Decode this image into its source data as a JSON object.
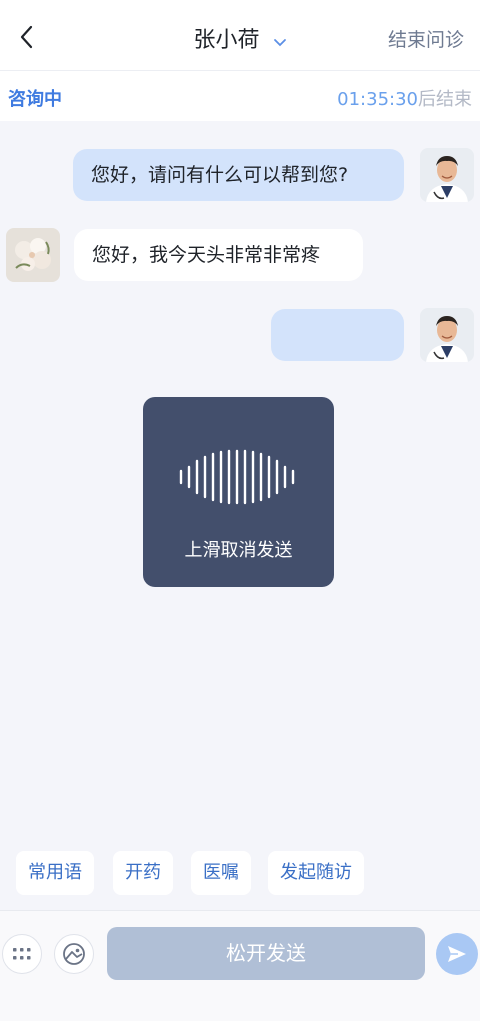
{
  "header": {
    "patient_name": "张小荷",
    "end_button": "结束问诊"
  },
  "status": {
    "state": "咨询中",
    "countdown": "01:35:30",
    "countdown_suffix": "后结束"
  },
  "messages": [
    {
      "side": "out",
      "text": "您好，请问有什么可以帮到您?",
      "avatar": "doctor-avatar"
    },
    {
      "side": "in",
      "text": "您好，我今天头非常非常疼",
      "avatar": "patient-avatar"
    },
    {
      "side": "out",
      "text": "",
      "avatar": "doctor-avatar"
    }
  ],
  "recording": {
    "hint": "上滑取消发送",
    "icon": "voice-wave-icon"
  },
  "quick_replies": [
    "常用语",
    "开药",
    "医嘱",
    "发起随访"
  ],
  "input_bar": {
    "hold_label": "松开发送",
    "left_icon": "grid-icon",
    "image_icon": "image-icon",
    "send_icon": "send-icon"
  },
  "colors": {
    "accent": "#3f7be0",
    "bubble_out": "#d3e3fb",
    "record_panel": "#434f6c"
  }
}
